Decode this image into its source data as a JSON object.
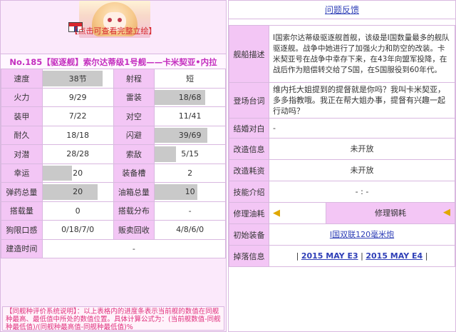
{
  "banner": {
    "note": "【点击可查看完整立绘】"
  },
  "ship": {
    "title": "No.185【驱逐舰】索尔达蒂级1号舰——卡米契亚•内拉"
  },
  "stats": [
    {
      "label": "速度",
      "value": "38节",
      "bar": 0.85,
      "label2": "射程",
      "value2": "短",
      "bar2": 0
    },
    {
      "label": "火力",
      "value": "9/29",
      "bar": 0,
      "label2": "雷装",
      "value2": "18/68",
      "bar2": 0.72
    },
    {
      "label": "装甲",
      "value": "7/22",
      "bar": 0,
      "label2": "对空",
      "value2": "11/41",
      "bar2": 0
    },
    {
      "label": "耐久",
      "value": "18/18",
      "bar": 0,
      "label2": "闪避",
      "value2": "39/69",
      "bar2": 0.75
    },
    {
      "label": "对潜",
      "value": "28/28",
      "bar": 0,
      "label2": "索敌",
      "value2": "5/15",
      "bar2": 0.3
    },
    {
      "label": "幸运",
      "value": "20",
      "bar": 0.42,
      "label2": "装备槽",
      "value2": "2",
      "bar2": 0
    },
    {
      "label": "弹药总量",
      "value": "20",
      "bar": 0.78,
      "label2": "油箱总量",
      "value2": "10",
      "bar2": 0.6
    },
    {
      "label": "搭载量",
      "value": "0",
      "bar": 0,
      "label2": "搭载分布",
      "value2": "-",
      "bar2": 0
    },
    {
      "label": "狗限口感",
      "value": "0/18/7/0",
      "bar": 0,
      "label2": "贩卖回收",
      "value2": "4/8/6/0",
      "bar2": 0
    }
  ],
  "build": {
    "label": "建造时间",
    "value": "-"
  },
  "note": "【同舰种评价系统说明】：以上表格内的进度条表示当前舰的数值在同舰种最高、最低值中所处的数值位置。具体计算公式为：(当前舰数值-同舰种最低值)/(同舰种最高值-同舰种最低值)%",
  "right": {
    "title": "问题反馈",
    "desc_label": "舰船描述",
    "desc": "I国索尔达蒂级驱逐舰首舰，该级是I国数量最多的舰队驱逐舰。战争中她进行了加强火力和防空的改装。卡米契亚号在战争中幸存下来，在43年向盟军投降，在战后作为赔偿转交给了S国，在S国服役到60年代。",
    "greet_label": "登场台词",
    "greet": "维内托大姐提到的提督就是你吗？我叫卡米契亚，多多指教哦。我正在帮大姐办事，提督有兴趣一起行动吗？",
    "marry_label": "结婚对白",
    "marry": "-",
    "remodel_label": "改造信息",
    "remodel": "未开放",
    "remodel_cost_label": "改造耗资",
    "remodel_cost": "未开放",
    "skill_label": "技能介绍",
    "skill": "- : -",
    "repair_oil_label": "修理油耗",
    "repair_steel_label": "修理钢耗",
    "init_equip_label": "初始装备",
    "init_equip": "I国双联120毫米炮",
    "drop_label": "掉落信息",
    "drop_sep": "|",
    "drop1": "2015 MAY E3",
    "drop2": "2015 MAY E4"
  }
}
